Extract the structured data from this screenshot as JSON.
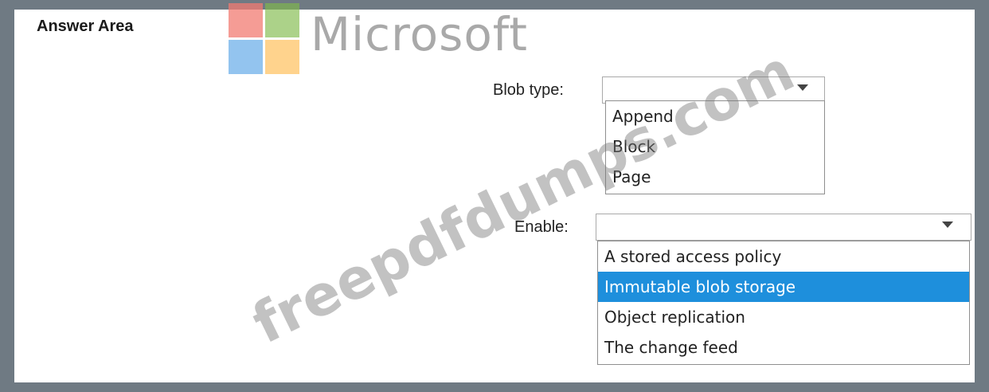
{
  "heading": "Answer Area",
  "logo": {
    "wordmark": "Microsoft",
    "colors": [
      "#f27b72",
      "#7fba4a",
      "#6fb0ea",
      "#ffc05c"
    ]
  },
  "blob_type": {
    "label": "Blob type:",
    "selected_value": "",
    "options": [
      "Append",
      "Block",
      "Page"
    ]
  },
  "enable": {
    "label": "Enable:",
    "selected_value": "",
    "options": [
      "A stored access policy",
      "Immutable blob storage",
      "Object replication",
      "The change feed"
    ],
    "highlighted": "Immutable blob storage"
  },
  "watermark": "freepdfdumps.com",
  "colors": {
    "highlight": "#1e8fdc",
    "frame": "#6f7a83"
  }
}
